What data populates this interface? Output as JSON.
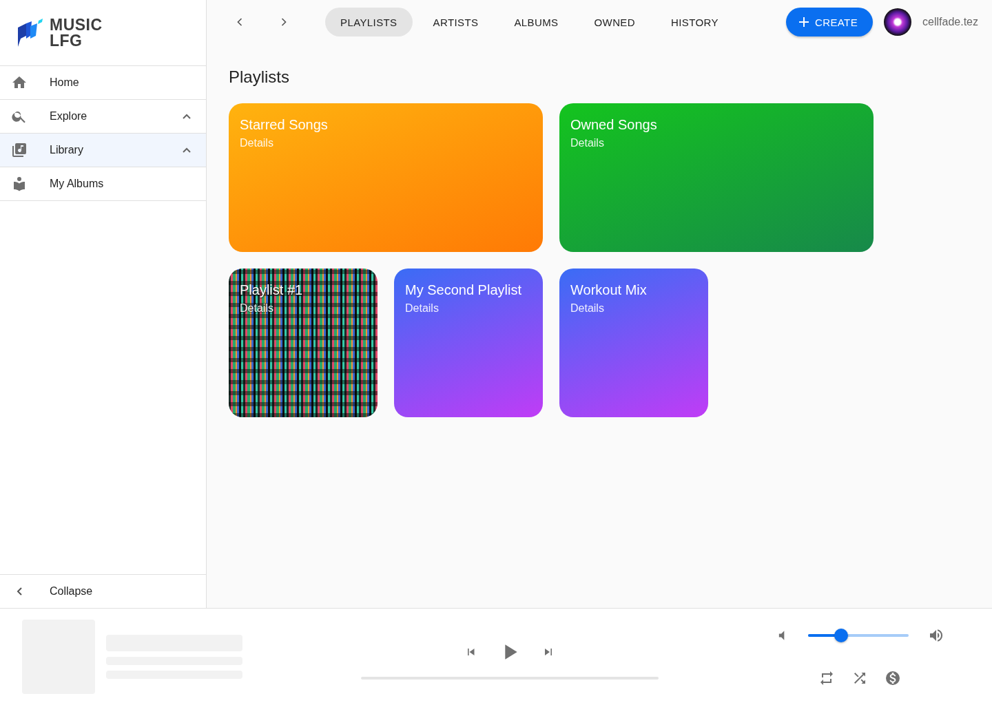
{
  "logo": {
    "line_1": "MUSIC",
    "line_2": "LFG"
  },
  "sidebar": {
    "items": [
      {
        "label": "Home",
        "selected": false
      },
      {
        "label": "Explore",
        "selected": false,
        "expanded": true
      },
      {
        "label": "Library",
        "selected": true,
        "expanded": true,
        "children": [
          {
            "label": "My Albums",
            "selected": false
          }
        ]
      }
    ],
    "collapse": "Collapse"
  },
  "nav": {
    "tabs": [
      {
        "label": "PLAYLISTS",
        "selected": true
      },
      {
        "label": "ARTISTS",
        "selected": false
      },
      {
        "label": "ALBUMS",
        "selected": false
      },
      {
        "label": "OWNED",
        "selected": false
      },
      {
        "label": "HISTORY",
        "selected": false
      }
    ],
    "create": "CREATE",
    "username": "cellfade.tez"
  },
  "page_title": "Playlists",
  "playlists": [
    {
      "title": "Starred Songs",
      "subtitle": "Details",
      "kind": "gradient",
      "color": "#ffb30f"
    },
    {
      "title": "Owned Songs",
      "subtitle": "Details",
      "kind": "gradient",
      "color": "#14c41e"
    },
    {
      "title": "Playlist #1",
      "subtitle": "Details",
      "kind": "image"
    },
    {
      "title": "My Second Playlist",
      "subtitle": "Details",
      "kind": "gradient",
      "color": "#3a6cf5"
    },
    {
      "title": "Workout Mix",
      "subtitle": "Details",
      "kind": "gradient",
      "color": "#3a6cf5"
    }
  ],
  "player": {
    "progress": {
      "level": 0
    },
    "volume": {
      "level": 0.33
    }
  }
}
